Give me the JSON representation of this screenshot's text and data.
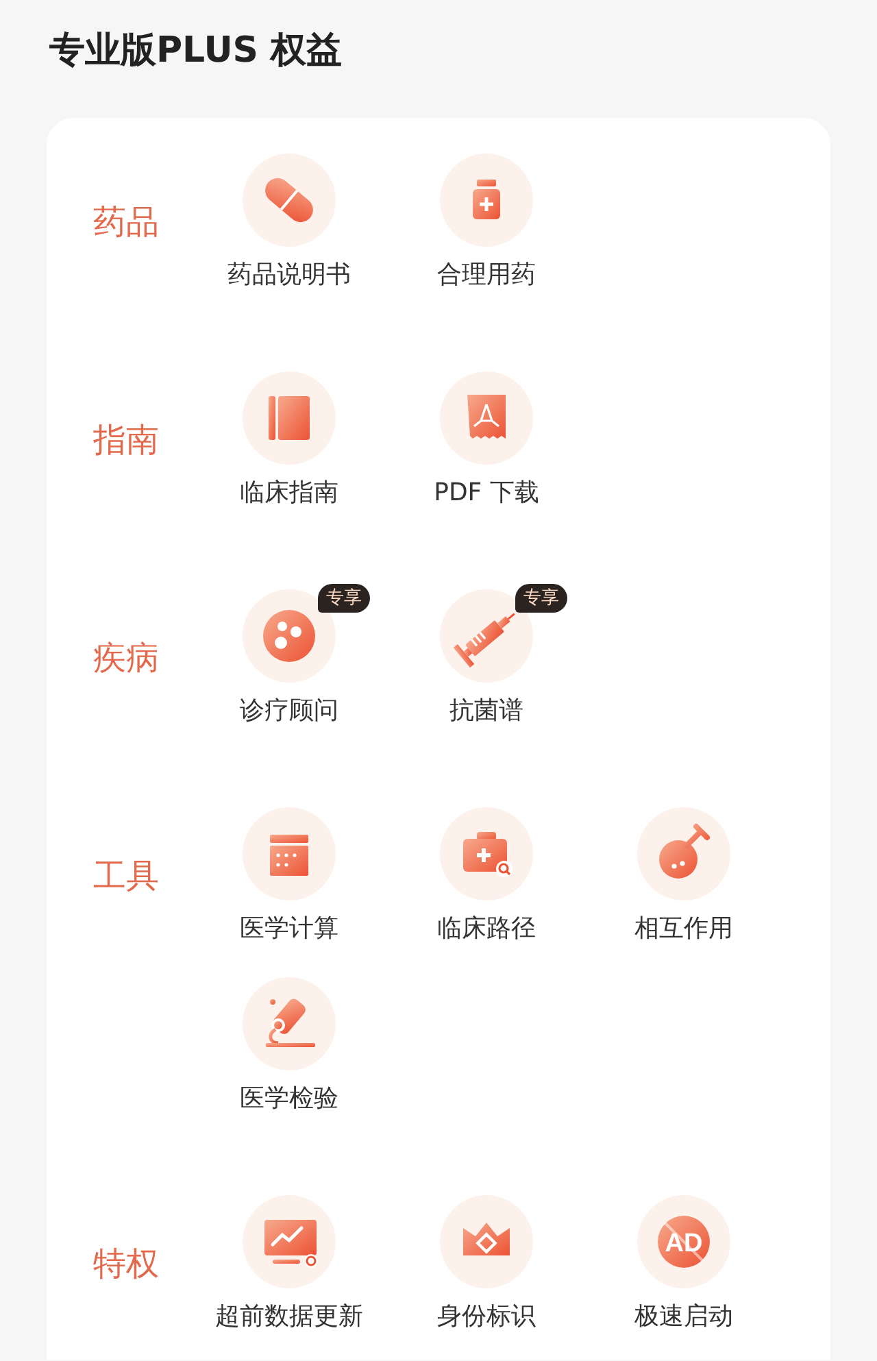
{
  "title": "专业版PLUS 权益",
  "sections": [
    {
      "label": "药品",
      "items": [
        {
          "label": "药品说明书",
          "kind": "pill"
        },
        {
          "label": "合理用药",
          "kind": "bottle"
        }
      ]
    },
    {
      "label": "指南",
      "items": [
        {
          "label": "临床指南",
          "kind": "book"
        },
        {
          "label": "PDF 下载",
          "kind": "pdf"
        }
      ]
    },
    {
      "label": "疾病",
      "items": [
        {
          "label": "诊疗顾问",
          "kind": "dish",
          "badge": "专享"
        },
        {
          "label": "抗菌谱",
          "kind": "syringe",
          "badge": "专享"
        }
      ]
    },
    {
      "label": "工具",
      "items": [
        {
          "label": "医学计算",
          "kind": "calc"
        },
        {
          "label": "临床路径",
          "kind": "kit"
        },
        {
          "label": "相互作用",
          "kind": "flask"
        },
        {
          "label": "医学检验",
          "kind": "scope"
        }
      ]
    },
    {
      "label": "特权",
      "items": [
        {
          "label": "超前数据更新",
          "kind": "monitor"
        },
        {
          "label": "身份标识",
          "kind": "crown"
        },
        {
          "label": "极速启动",
          "kind": "noad",
          "icon_text": "AD"
        }
      ]
    }
  ]
}
